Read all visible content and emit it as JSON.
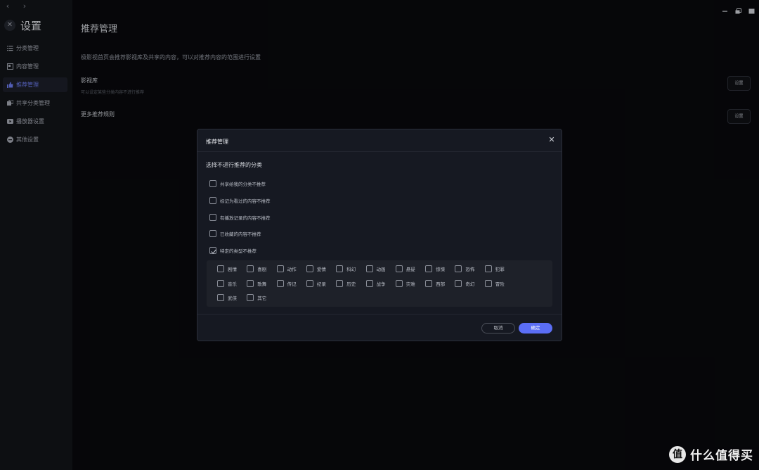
{
  "sidebar": {
    "title": "设置",
    "items": [
      {
        "label": "分类管理",
        "icon": "list-icon"
      },
      {
        "label": "内容管理",
        "icon": "content-icon"
      },
      {
        "label": "推荐管理",
        "icon": "thumbs-up-icon",
        "active": true
      },
      {
        "label": "共享分类管理",
        "icon": "share-icon"
      },
      {
        "label": "播放器设置",
        "icon": "player-icon"
      },
      {
        "label": "其他设置",
        "icon": "more-icon"
      }
    ]
  },
  "main": {
    "title": "推荐管理",
    "description": "极影视首页会推荐影视库及共享的内容，可以对推荐内容的范围进行设置",
    "sections": [
      {
        "title": "影视库",
        "subtitle": "可以设定某些分类内容不进行推荐",
        "button": "设置"
      },
      {
        "title": "更多推荐规则",
        "button": "设置"
      }
    ]
  },
  "dialog": {
    "title": "推荐管理",
    "subtitle": "选择不进行推荐的分类",
    "options": [
      {
        "label": "共享给我的分类不推荐",
        "checked": false
      },
      {
        "label": "标记为看过的内容不推荐",
        "checked": false
      },
      {
        "label": "有播放记录的内容不推荐",
        "checked": false
      },
      {
        "label": "已收藏的内容不推荐",
        "checked": false
      },
      {
        "label": "特定的类型不推荐",
        "checked": true
      }
    ],
    "genres": [
      "剧情",
      "喜剧",
      "动作",
      "爱情",
      "科幻",
      "动画",
      "悬疑",
      "惊悚",
      "恐怖",
      "犯罪",
      "音乐",
      "歌舞",
      "传记",
      "纪录",
      "历史",
      "战争",
      "灾难",
      "西部",
      "奇幻",
      "冒险",
      "武侠",
      "其它"
    ],
    "cancel": "取消",
    "confirm": "确定"
  },
  "watermark": {
    "text": "什么值得买",
    "logo": "值"
  },
  "colors": {
    "accent": "#5b6ef5",
    "background": "#08090c",
    "sidebar": "#121419",
    "dialog": "#161922"
  }
}
